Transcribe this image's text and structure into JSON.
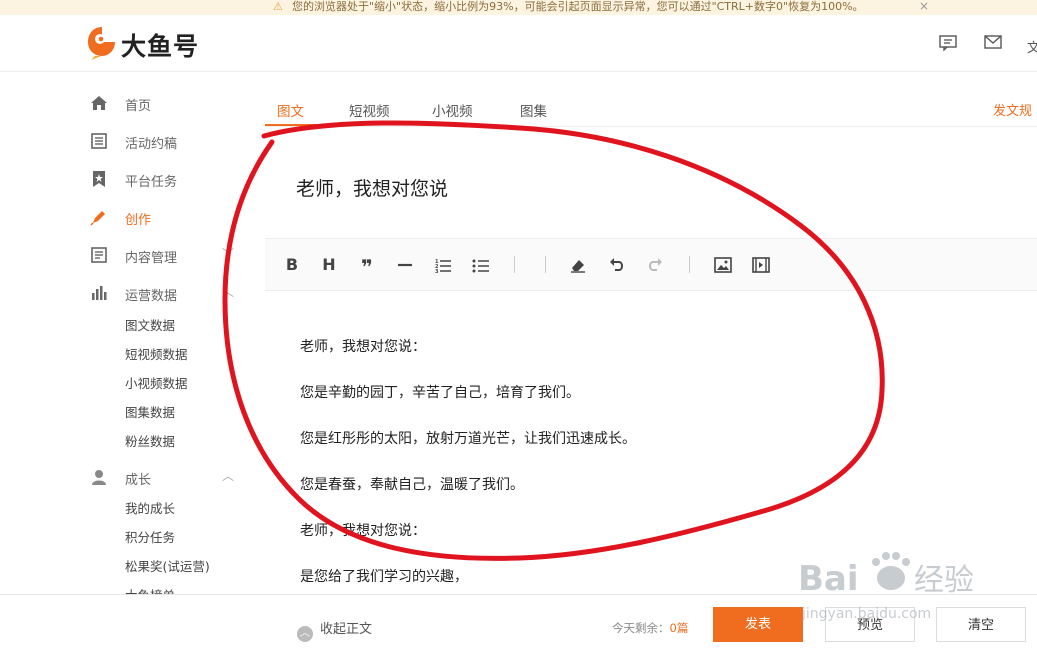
{
  "notice": {
    "message": "您的浏览器处于\"缩小\"状态，缩小比例为93%，可能会引起页面显示异常，您可以通过\"CTRL+数字0\"恢复为100%。"
  },
  "header": {
    "brand": "大鱼号",
    "cut_text": "文"
  },
  "sidebar": {
    "items": [
      {
        "label": "首页"
      },
      {
        "label": "活动约稿"
      },
      {
        "label": "平台任务"
      },
      {
        "label": "创作"
      },
      {
        "label": "内容管理"
      },
      {
        "label": "运营数据"
      },
      {
        "label": "成长"
      }
    ],
    "data_subitems": [
      "图文数据",
      "短视频数据",
      "小视频数据",
      "图集数据",
      "粉丝数据"
    ],
    "growth_subitems": [
      "我的成长",
      "积分任务",
      "松果奖(试运营)",
      "大鱼榜单"
    ]
  },
  "tabs": [
    "图文",
    "短视频",
    "小视频",
    "图集"
  ],
  "rules_link": "发文规",
  "editor": {
    "title": "老师，我想对您说",
    "paragraphs": [
      "老师，我想对您说：",
      "您是辛勤的园丁，辛苦了自己，培育了我们。",
      "您是红彤彤的太阳，放射万道光芒，让我们迅速成长。",
      "您是春蚕，奉献自己，温暖了我们。",
      "老师，我想对您说：",
      "是您给了我们学习的兴趣，"
    ]
  },
  "footer": {
    "collapse_label": "收起正文",
    "remain_label": "今天剩余：",
    "remain_count": "0篇",
    "publish": "发表",
    "preview": "预览",
    "clear": "清空"
  },
  "watermark": {
    "text": "Bai",
    "text2": "经验",
    "url": "jingyan.baidu.com"
  },
  "colors": {
    "accent": "#f06d1f",
    "annotation": "#e0141e"
  }
}
